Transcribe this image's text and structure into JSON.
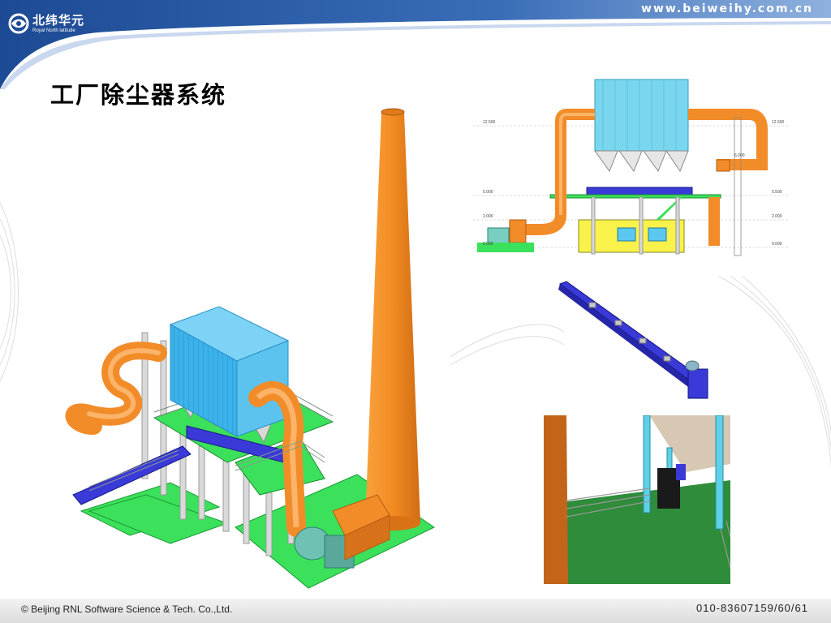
{
  "header": {
    "logo_cn": "北纬华元",
    "logo_en": "Royal North latitude",
    "site_url": "www.beiweihy.com.cn"
  },
  "slide": {
    "title": "工厂除尘器系统"
  },
  "elevation_labels": {
    "top_left": "12.500",
    "top_right": "12.500",
    "mid_left": "5.000",
    "mid_right": "5.500",
    "low_left": "2.000",
    "low_right": "2.000",
    "base_left": "0.000",
    "base_right": "0.000",
    "inner": "6.000"
  },
  "footer": {
    "company": "© Beijing RNL Software Science & Tech. Co.,Ltd.",
    "page_info": "010-83607159/60/61"
  },
  "colors": {
    "header_blue": "#1f4e9a",
    "duct_orange": "#f28c28",
    "filter_blue": "#3fb0e8",
    "platform_green": "#33d85a",
    "conveyor_blue": "#3a3ad8"
  }
}
